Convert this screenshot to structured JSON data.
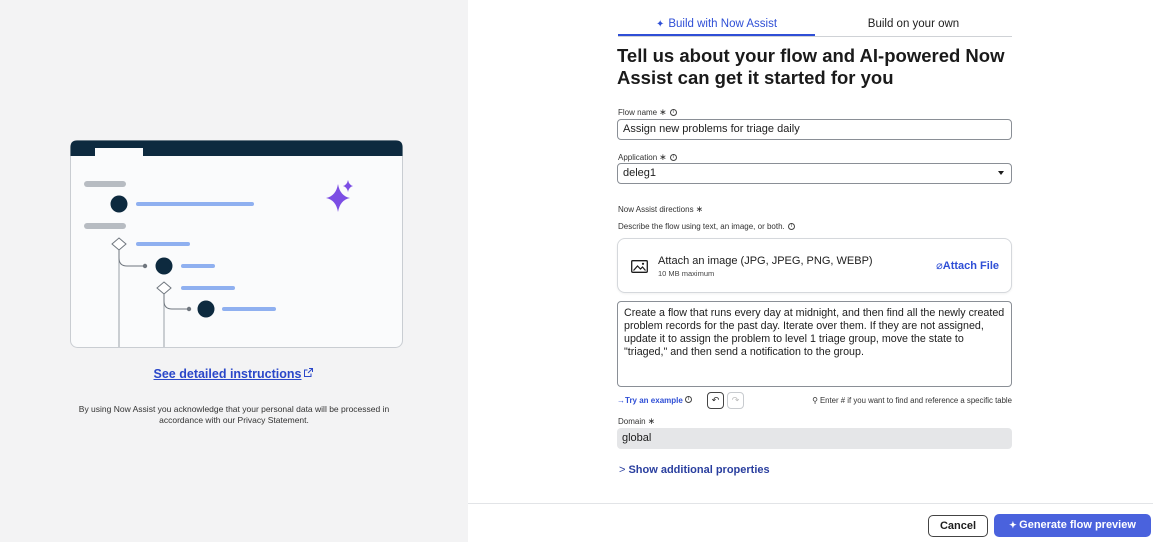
{
  "left": {
    "instructions_link": "See detailed instructions",
    "privacy_text": "By using Now Assist you acknowledge that your personal data will be processed in accordance with our Privacy Statement."
  },
  "tabs": [
    {
      "label": "Build with Now Assist",
      "active": true
    },
    {
      "label": "Build on your own",
      "active": false
    }
  ],
  "heading": "Tell us about your flow and AI-powered Now Assist can get it started for you",
  "flow_name": {
    "label": "Flow name",
    "value": "Assign new problems for triage daily"
  },
  "application": {
    "label": "Application",
    "value": "deleg1"
  },
  "directions": {
    "label": "Now Assist directions",
    "sublabel": "Describe the flow using text, an image, or both.",
    "attach_title": "Attach an image (JPG, JPEG, PNG, WEBP)",
    "attach_sub": "10 MB maximum",
    "attach_button": "Attach File",
    "text": "Create a flow that runs every day at midnight, and then find all the newly created problem records for the past day. Iterate over them. If they are not assigned, update it to assign the problem to level 1 triage group, move the state to \"triaged,\" and then send a notification to the group.",
    "try_example": "Try an example",
    "hint": "Enter # if you want to find and reference a specific table"
  },
  "domain": {
    "label": "Domain",
    "value": "global"
  },
  "show_more": "Show additional properties",
  "footer": {
    "cancel": "Cancel",
    "generate": "Generate flow preview"
  },
  "colors": {
    "accent": "#2f4fd6",
    "primary_button": "#4a62dd",
    "navy": "#0d2a3f",
    "spark": "#7c4ee4"
  }
}
